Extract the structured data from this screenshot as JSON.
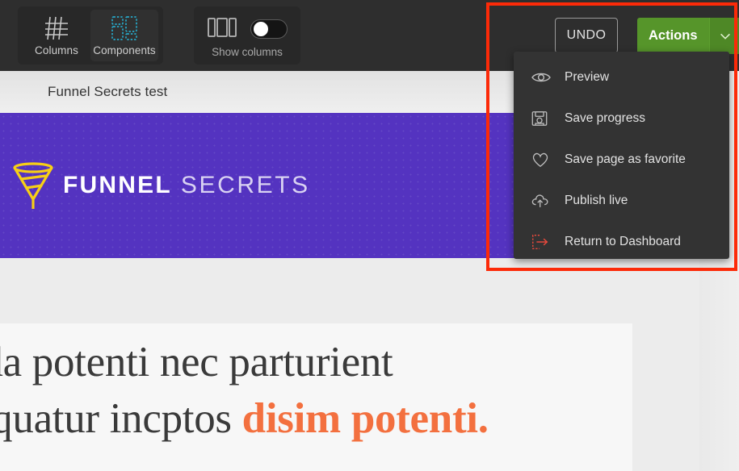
{
  "toolbar": {
    "columns_label": "Columns",
    "columns_icon": "grid-icon",
    "components_label": "Components",
    "components_icon": "components-blocks-icon",
    "show_columns_label": "Show columns",
    "show_columns_icon": "three-columns-icon",
    "show_columns_toggle_state": "off",
    "undo_label": "UNDO",
    "actions_label": "Actions",
    "actions_caret_icon": "chevron-down-icon",
    "actions_color": "#56952a"
  },
  "actions_menu": {
    "items": [
      {
        "label": "Preview",
        "icon": "eye-icon"
      },
      {
        "label": "Save progress",
        "icon": "floppy-disk-icon"
      },
      {
        "label": "Save page as favorite",
        "icon": "heart-icon"
      },
      {
        "label": "Publish live",
        "icon": "cloud-upload-icon"
      },
      {
        "label": "Return to Dashboard",
        "icon": "exit-arrow-icon"
      }
    ],
    "background": "#333333"
  },
  "page": {
    "title": "Funnel Secrets test",
    "hero": {
      "logo_word_1": "FUNNEL",
      "logo_word_2": "SECRETS",
      "logo_icon": "funnel-icon",
      "background_color": "#5433c0",
      "logo_mark_color": "#f7cf16"
    },
    "content": {
      "headline_line_1": "gravida potenti nec parturient",
      "headline_line_2_plain": "consequatur incptos ",
      "headline_line_2_accent": "disim potenti.",
      "accent_color": "#f3703f"
    }
  },
  "annotation": {
    "type": "highlight-rectangle",
    "color": "#fc2a08"
  }
}
